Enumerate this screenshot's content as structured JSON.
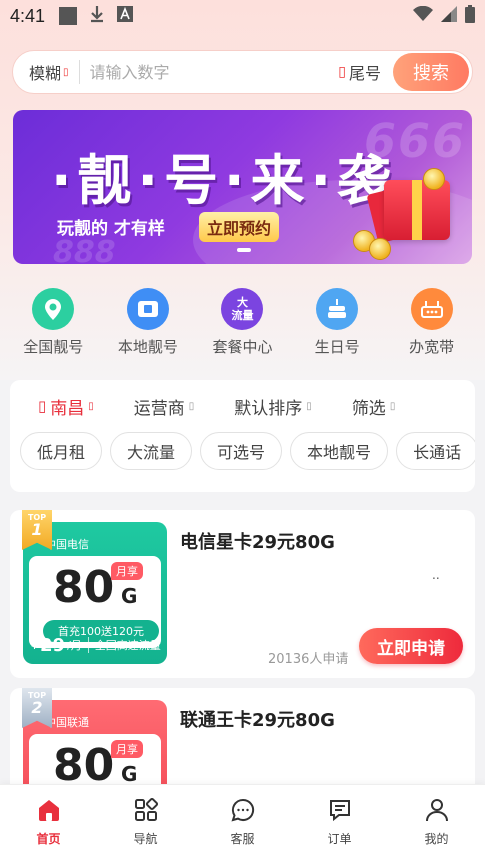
{
  "status_bar": {
    "time": "4:41"
  },
  "search": {
    "mode_label": "模糊",
    "mode_icon": "chevron-down-icon",
    "placeholder": "请输入数字",
    "tail_label": "尾号",
    "button_label": "搜索"
  },
  "banner": {
    "title": "·靓·号·来·袭",
    "subtitle": "玩靓的 才有样",
    "cta": "立即预约",
    "deco_top": "666",
    "deco_bottom": "888"
  },
  "categories": [
    {
      "label": "全国靓号",
      "icon": "location-pin-icon",
      "color": "#2ccfa0"
    },
    {
      "label": "本地靓号",
      "icon": "sim-card-icon",
      "color": "#3f8ef5"
    },
    {
      "label": "套餐中心",
      "icon_text": "大\n流量",
      "icon": "big-traffic-icon",
      "color": "#7b44e0"
    },
    {
      "label": "生日号",
      "icon": "cake-icon",
      "color": "#4fa6f2"
    },
    {
      "label": "办宽带",
      "icon": "router-icon",
      "color": "#ff8a3c"
    }
  ],
  "filters": {
    "tabs": [
      {
        "label": "南昌",
        "active": true
      },
      {
        "label": "运营商",
        "active": false
      },
      {
        "label": "默认排序",
        "active": false
      },
      {
        "label": "筛选",
        "active": false
      }
    ],
    "chips": [
      "低月租",
      "大流量",
      "可选号",
      "本地靓号",
      "长通话"
    ]
  },
  "products": [
    {
      "rank_label": "TOP",
      "rank": "1",
      "carrier": "中国电信",
      "data_amount": "80",
      "data_unit": "G",
      "tag": "月享",
      "promo": "首充100送120元",
      "price_prefix": "¥",
      "price": "29",
      "price_unit": "/月",
      "feature": "全国高速流量",
      "title": "电信星卡29元80G",
      "dots": "..",
      "applicants": "20136人申请",
      "button": "立即申请",
      "theme": "#13b28f"
    },
    {
      "rank_label": "TOP",
      "rank": "2",
      "carrier": "中国联通",
      "data_amount": "80",
      "data_unit": "G",
      "tag": "月享",
      "title": "联通王卡29元80G",
      "theme": "#f0424e"
    }
  ],
  "bottom_nav": [
    {
      "label": "首页",
      "icon": "home-icon",
      "active": true
    },
    {
      "label": "导航",
      "icon": "grid-icon",
      "active": false
    },
    {
      "label": "客服",
      "icon": "chat-icon",
      "active": false
    },
    {
      "label": "订单",
      "icon": "order-icon",
      "active": false
    },
    {
      "label": "我的",
      "icon": "user-icon",
      "active": false
    }
  ],
  "colors": {
    "accent": "#e8303d",
    "search_button": "#ff8a6c",
    "banner": "#8f3ae0"
  }
}
